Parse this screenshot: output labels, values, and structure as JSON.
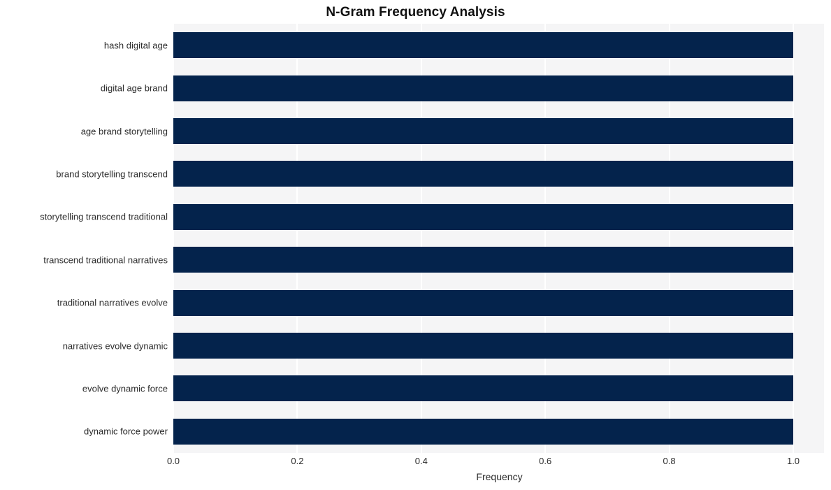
{
  "chart_data": {
    "type": "bar",
    "orientation": "horizontal",
    "title": "N-Gram Frequency Analysis",
    "xlabel": "Frequency",
    "ylabel": "",
    "categories": [
      "hash digital age",
      "digital age brand",
      "age brand storytelling",
      "brand storytelling transcend",
      "storytelling transcend traditional",
      "transcend traditional narratives",
      "traditional narratives evolve",
      "narratives evolve dynamic",
      "evolve dynamic force",
      "dynamic force power"
    ],
    "values": [
      1.0,
      1.0,
      1.0,
      1.0,
      1.0,
      1.0,
      1.0,
      1.0,
      1.0,
      1.0
    ],
    "xlim": [
      0.0,
      1.0
    ],
    "xticks": [
      "0.0",
      "0.2",
      "0.4",
      "0.6",
      "0.8",
      "1.0"
    ],
    "xtick_values": [
      0.0,
      0.2,
      0.4,
      0.6,
      0.8,
      1.0
    ],
    "grid": "vertical",
    "legend": "none",
    "bar_color": "#04234c",
    "plot_background": "#f5f5f6",
    "gridline_color": "#ffffff",
    "figure_background": "#ffffff"
  }
}
